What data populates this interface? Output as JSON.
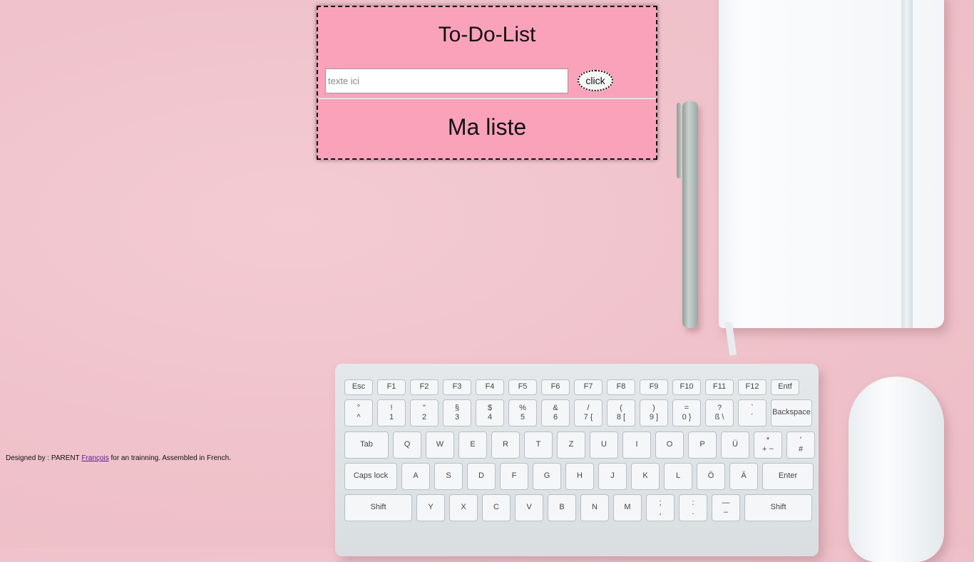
{
  "todo": {
    "title": "To-Do-List",
    "input_placeholder": "texte ici",
    "button_label": "click",
    "list_heading": "Ma liste"
  },
  "footer": {
    "prefix": "Designed by : PARENT ",
    "link_text": "François",
    "suffix": " for an trainning. Assembled in French."
  },
  "keyboard": {
    "fn_row": [
      "Esc",
      "F1",
      "F2",
      "F3",
      "F4",
      "F5",
      "F6",
      "F7",
      "F8",
      "F9",
      "F10",
      "F11",
      "F12",
      "Entf"
    ],
    "num_row": [
      "°\n^",
      "!\n1",
      "\"\n2",
      "§\n3",
      "$\n4",
      "%\n5",
      "&\n6",
      "/\n7 {",
      "(\n8 [",
      ")\n9 ]",
      "=\n0 }",
      "?\nß \\",
      "`\n´",
      "Backspace"
    ],
    "qwertz_row": [
      "Tab",
      "Q",
      "W",
      "E",
      "R",
      "T",
      "Z",
      "U",
      "I",
      "O",
      "P",
      "Ü",
      "*\n+ ~",
      "'\n#"
    ],
    "home_row": [
      "Caps lock",
      "A",
      "S",
      "D",
      "F",
      "G",
      "H",
      "J",
      "K",
      "L",
      "Ö",
      "Ä",
      "Enter"
    ],
    "shift_row": [
      "Shift",
      "Y",
      "X",
      "C",
      "V",
      "B",
      "N",
      "M",
      ";\n,",
      ":\n.",
      "—\n–",
      "Shift"
    ]
  }
}
